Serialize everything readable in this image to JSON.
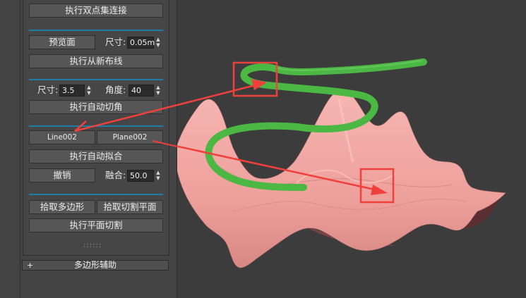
{
  "panel": {
    "btn_double_point": "执行双点集连接",
    "btn_preview_face": "预览面",
    "size_label_1": "尺寸:",
    "size_value_1": "0.05m",
    "btn_rebuild_lines": "执行从新布线",
    "size_label_2": "尺寸:",
    "size_value_2": "3.5",
    "angle_label": "角度:",
    "angle_value": "40",
    "btn_auto_chamfer": "执行自动切角",
    "btn_line": "Line002",
    "btn_plane": "Plane002",
    "btn_auto_fit": "执行自动拟合",
    "btn_undo": "撤销",
    "blend_label": "融合:",
    "blend_value": "50.0",
    "btn_pick_polygon": "拾取多边形",
    "btn_pick_cut_plane": "拾取切割平面",
    "btn_plane_cut": "执行平面切割",
    "grip": "::::::",
    "rollout_polygon_helper": "多边形辅助",
    "rollout_plus": "+"
  },
  "colors": {
    "accent_separator": "#1f7ea8",
    "spline": "#4cb844",
    "surface": "#f2a7a4",
    "annotation": "#f0403c"
  }
}
